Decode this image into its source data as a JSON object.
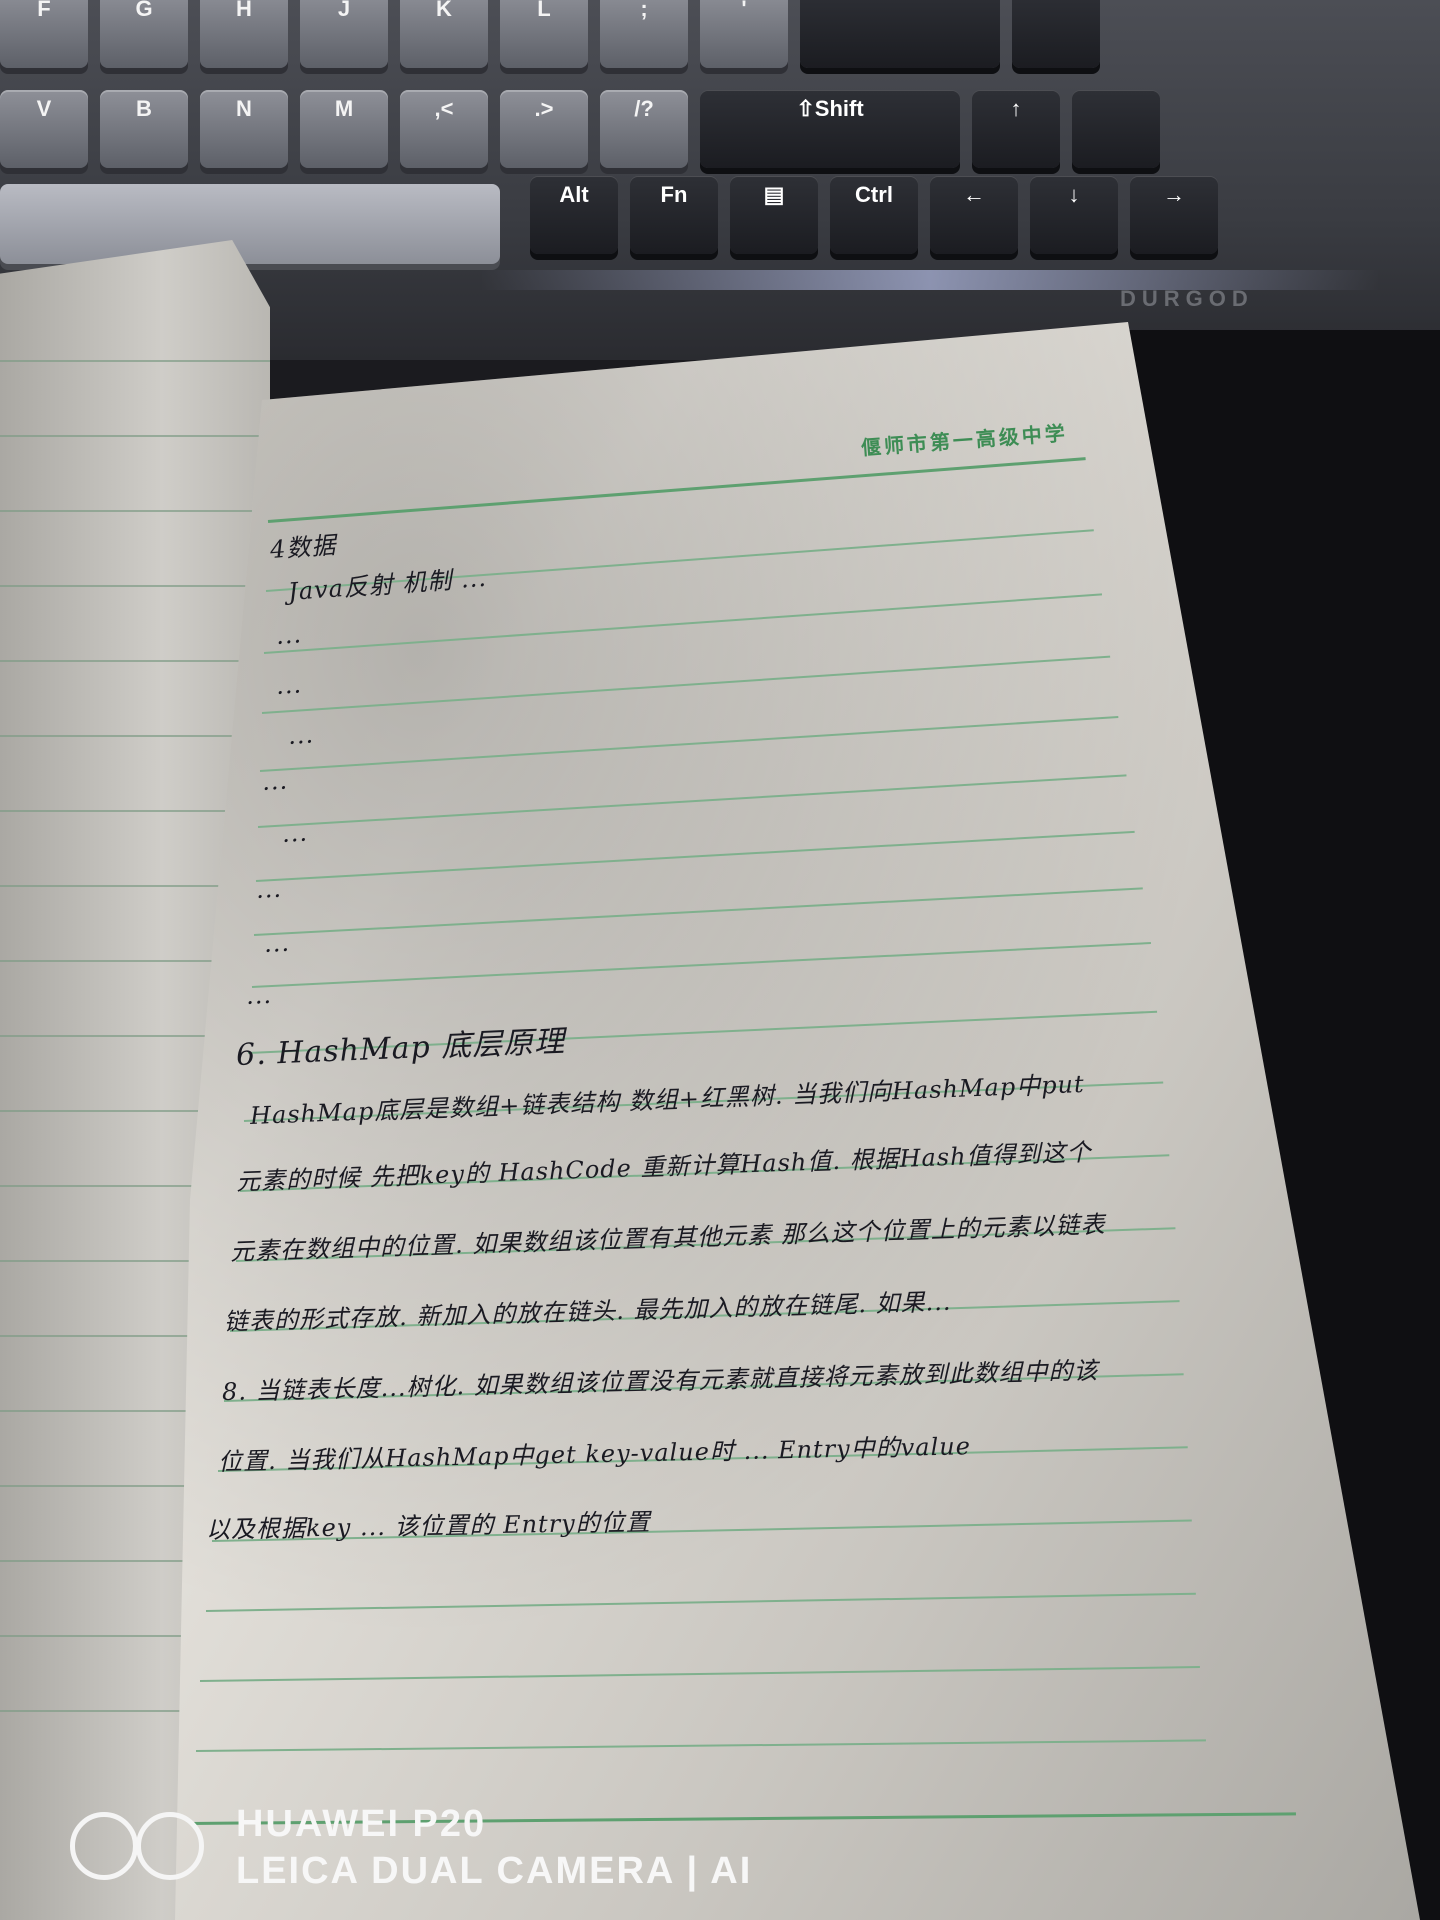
{
  "keyboard": {
    "row1": [
      "F",
      "G",
      "H",
      "J",
      "K",
      "L",
      ";",
      "'"
    ],
    "row2": [
      "V",
      "B",
      "N",
      "M",
      ",<",
      ".>",
      "/?",
      "⇧Shift"
    ],
    "row3": [
      "Alt",
      "Fn",
      "▤",
      "Ctrl",
      "←",
      "↓",
      "→"
    ],
    "arrow_up": "↑",
    "brand": "DURGOD"
  },
  "notebook": {
    "header": "偃师市第一高级中学",
    "lines": [
      "4数据",
      "Java反射 机制 ...",
      "...",
      "...",
      "...",
      "...",
      "...",
      "...",
      "...",
      "...",
      "6. HashMap 底层原理",
      "HashMap底层是数组+链表结构 数组+红黑树. 当我们向HashMap中put",
      "元素的时候 先把key的 HashCode 重新计算Hash值. 根据Hash值得到这个",
      "元素在数组中的位置. 如果数组该位置有其他元素 那么这个位置上的元素以链表",
      "链表的形式存放. 新加入的放在链头. 最先加入的放在链尾. 如果...",
      "8. 当链表长度...树化. 如果数组该位置没有元素就直接将元素放到此数组中的该",
      "位置. 当我们从HashMap中get key-value时 ... Entry中的value",
      "以及根据key ... 该位置的 Entry的位置"
    ]
  },
  "watermark": {
    "model": "HUAWEI P20",
    "camera": "LEICA DUAL CAMERA | AI"
  }
}
